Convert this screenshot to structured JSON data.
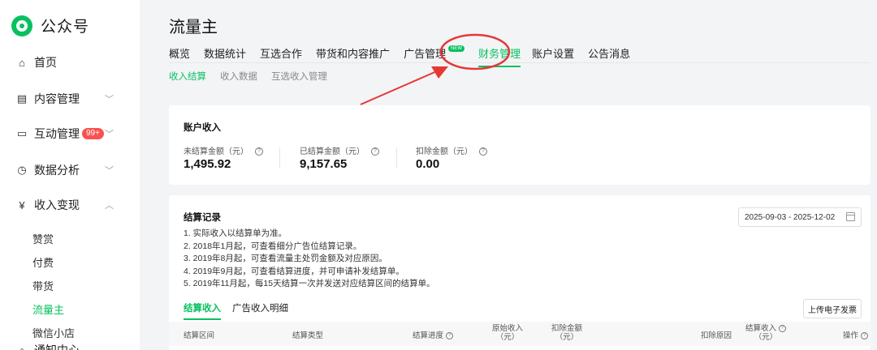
{
  "app": {
    "name": "公众号"
  },
  "sidebar": {
    "items": [
      {
        "label": "首页",
        "icon": "home-icon",
        "glyph": "⌂"
      },
      {
        "label": "内容管理",
        "icon": "document-icon",
        "glyph": "▤"
      },
      {
        "label": "互动管理",
        "icon": "chat-icon",
        "glyph": "▭",
        "badge": "99+"
      },
      {
        "label": "数据分析",
        "icon": "clock-icon",
        "glyph": "◷"
      },
      {
        "label": "收入变现",
        "icon": "yen-icon",
        "glyph": "¥"
      }
    ],
    "sub_items": [
      "赞赏",
      "付费",
      "带货",
      "流量主",
      "微信小店"
    ],
    "partial_item": "通知中心"
  },
  "page": {
    "title": "流量主",
    "tabs": [
      "概览",
      "数据统计",
      "互选合作",
      "带货和内容推广",
      "广告管理",
      "财务管理",
      "账户设置",
      "公告消息"
    ],
    "new_badge": "NEW",
    "subtabs": [
      "收入结算",
      "收入数据",
      "互选收入管理"
    ]
  },
  "account_income": {
    "title": "账户收入",
    "metrics": [
      {
        "label": "未结算金额（元）",
        "value": "1,495.92"
      },
      {
        "label": "已结算金额（元）",
        "value": "9,157.65"
      },
      {
        "label": "扣除金额（元）",
        "value": "0.00"
      }
    ]
  },
  "settlement": {
    "title": "结算记录",
    "date_range": "2025-09-03 - 2025-12-02",
    "notes": [
      "1. 实际收入以结算单为准。",
      "2. 2018年1月起，可查看细分广告位结算记录。",
      "3. 2019年8月起，可查看流量主处罚金额及对应原因。",
      "4. 2019年9月起，可查看结算进度，并可申请补发结算单。",
      "5. 2019年11月起，每15天结算一次并发送对应结算区间的结算单。"
    ],
    "tabs": [
      "结算收入",
      "广告收入明细"
    ],
    "upload_button": "上传电子发票",
    "columns": {
      "period": "结算区间",
      "type": "结算类型",
      "progress": "结算进度",
      "original_1": "原始收入",
      "original_2": "（元）",
      "deduct_1": "扣除金额",
      "deduct_2": "（元）",
      "reason": "扣除原因",
      "income_1": "结算收入",
      "income_2": "（元）",
      "action": "操作"
    }
  },
  "colors": {
    "accent": "#07c160",
    "badge": "#fa5151",
    "annotation": "#e53935"
  }
}
